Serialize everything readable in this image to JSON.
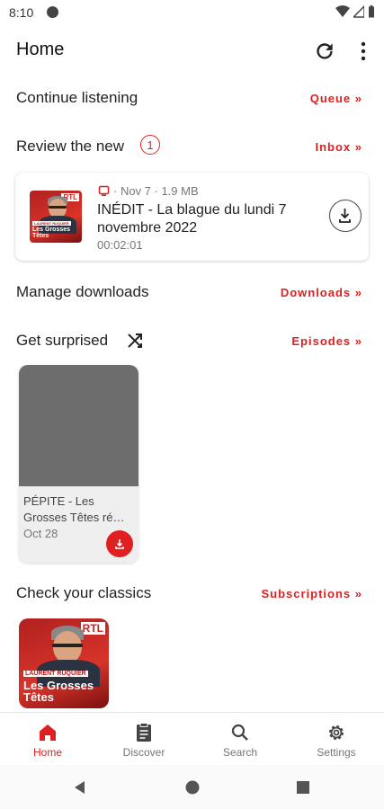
{
  "status_bar": {
    "time": "8:10",
    "icons": [
      "google-g-icon",
      "wifi-icon",
      "signal-icon",
      "battery-icon"
    ]
  },
  "app_bar": {
    "title": "Home",
    "icons": [
      "refresh-icon",
      "more-vert-icon"
    ]
  },
  "sections": {
    "continue_listening": {
      "title": "Continue listening",
      "link": "Queue »"
    },
    "review_new": {
      "title": "Review the new",
      "badge": "1",
      "link": "Inbox »"
    },
    "manage_downloads": {
      "title": "Manage downloads",
      "link": "Downloads »"
    },
    "get_surprised": {
      "title": "Get surprised",
      "link": "Episodes »",
      "icon": "shuffle-icon"
    },
    "check_classics": {
      "title": "Check your classics",
      "link": "Subscriptions »"
    }
  },
  "new_episode": {
    "meta": "· Nov 7 · 1.9 MB",
    "title": "INÉDIT - La blague du lundi 7 novembre 2022",
    "duration": "00:02:01",
    "thumb_brand": "RTL",
    "thumb_banner": "LAURENT RUQUIER",
    "thumb_show": "Les Grosses Têtes"
  },
  "surprise_episode": {
    "title": "PÉPITE - Les Grosses Têtes ré…",
    "date": "Oct 28"
  },
  "classic_podcast": {
    "brand": "RTL",
    "banner": "LAURENT RUQUIER",
    "show": "Les Grosses Têtes"
  },
  "bottom_nav": {
    "items": [
      {
        "label": "Home",
        "icon": "home-icon",
        "active": true
      },
      {
        "label": "Discover",
        "icon": "discover-icon",
        "active": false
      },
      {
        "label": "Search",
        "icon": "search-icon",
        "active": false
      },
      {
        "label": "Settings",
        "icon": "settings-icon",
        "active": false
      }
    ]
  },
  "system_nav": [
    "back-icon",
    "home-circle-icon",
    "recents-icon"
  ],
  "colors": {
    "accent": "#e02020",
    "text": "#1f1f1f",
    "muted": "#777777",
    "placeholder_image": "#6d6d6d"
  }
}
